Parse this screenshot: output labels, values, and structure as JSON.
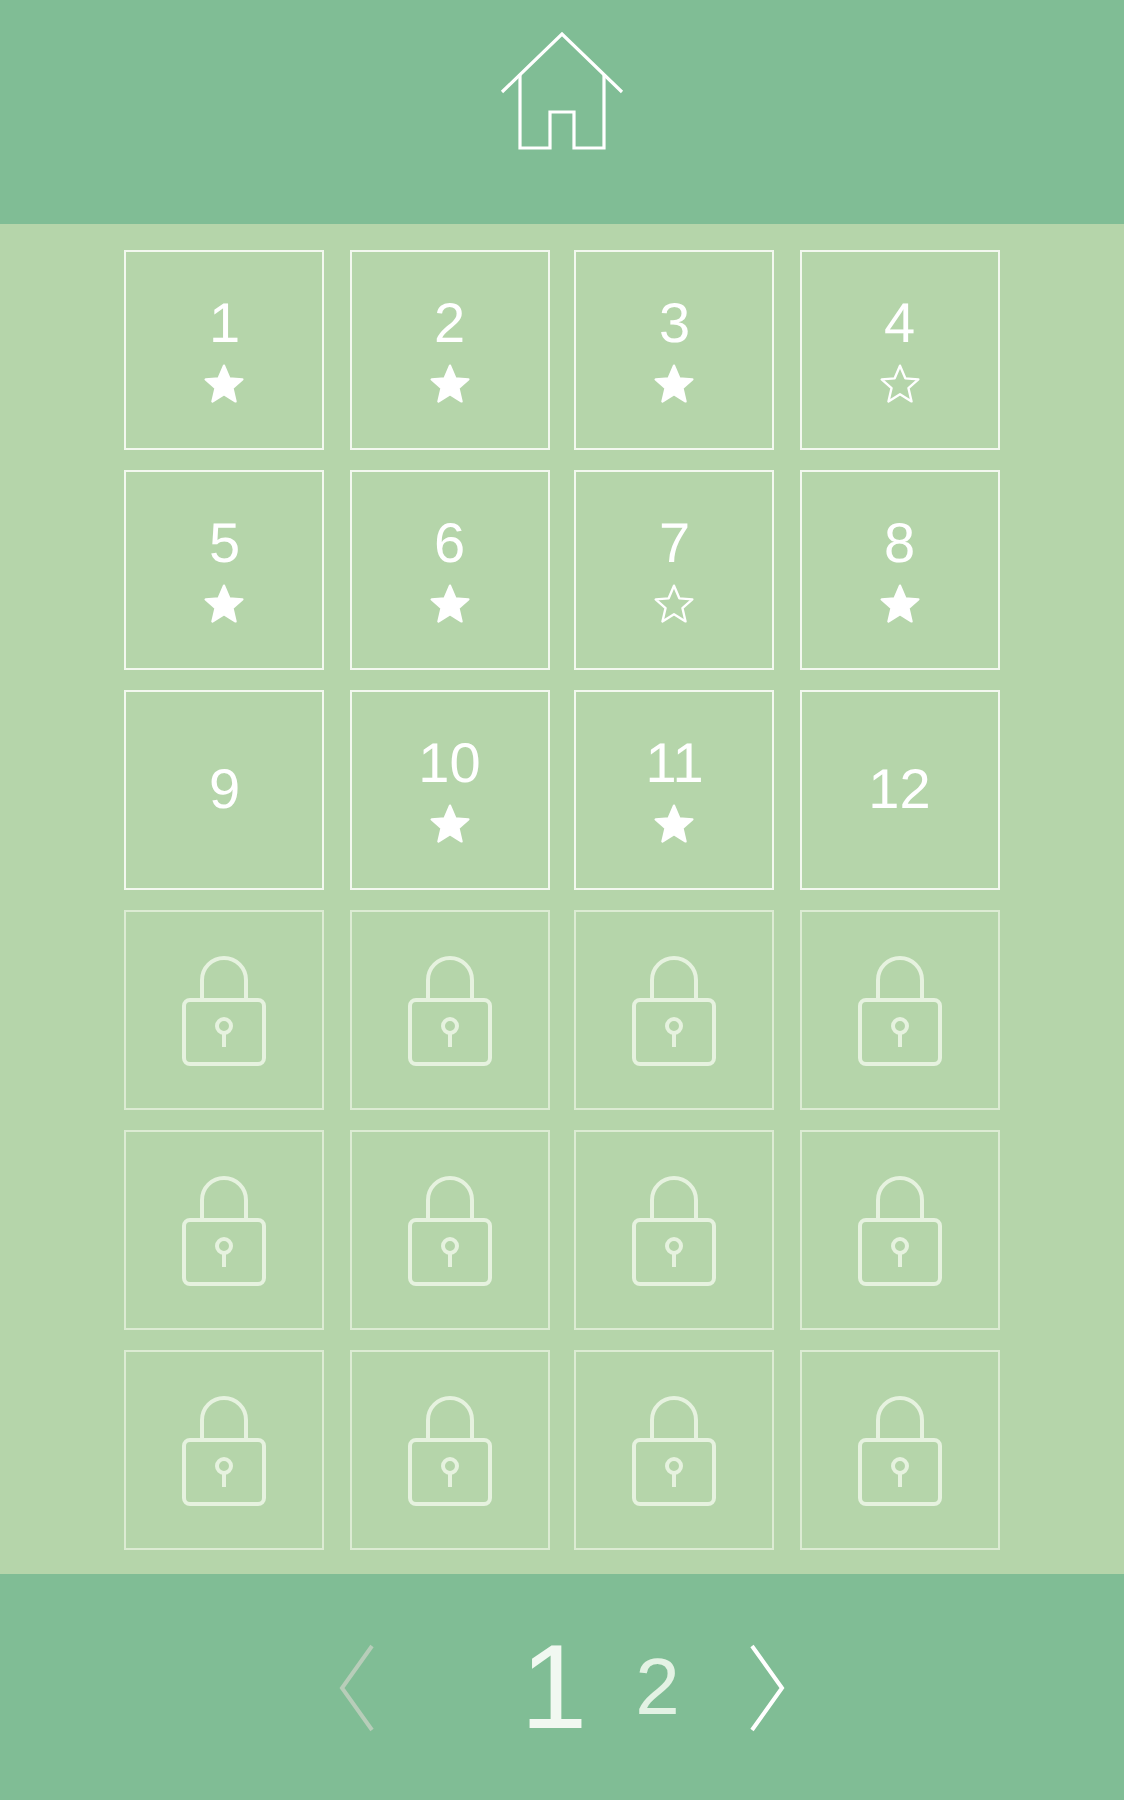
{
  "levels": [
    {
      "kind": "open",
      "label": "1",
      "starred": true
    },
    {
      "kind": "open",
      "label": "2",
      "starred": true
    },
    {
      "kind": "open",
      "label": "3",
      "starred": true
    },
    {
      "kind": "open",
      "label": "4",
      "starred": false
    },
    {
      "kind": "open",
      "label": "5",
      "starred": true
    },
    {
      "kind": "open",
      "label": "6",
      "starred": true
    },
    {
      "kind": "open",
      "label": "7",
      "starred": false
    },
    {
      "kind": "open",
      "label": "8",
      "starred": true
    },
    {
      "kind": "new",
      "label": "9"
    },
    {
      "kind": "open",
      "label": "10",
      "starred": true
    },
    {
      "kind": "open",
      "label": "11",
      "starred": true
    },
    {
      "kind": "new",
      "label": "12"
    },
    {
      "kind": "locked"
    },
    {
      "kind": "locked"
    },
    {
      "kind": "locked"
    },
    {
      "kind": "locked"
    },
    {
      "kind": "locked"
    },
    {
      "kind": "locked"
    },
    {
      "kind": "locked"
    },
    {
      "kind": "locked"
    },
    {
      "kind": "locked"
    },
    {
      "kind": "locked"
    },
    {
      "kind": "locked"
    },
    {
      "kind": "locked"
    }
  ],
  "pager": {
    "previous": {
      "disabled": true
    },
    "pages": [
      {
        "label": "1",
        "selected": true
      },
      {
        "label": "2",
        "selected": false
      }
    ],
    "next": {
      "disabled": false
    }
  }
}
